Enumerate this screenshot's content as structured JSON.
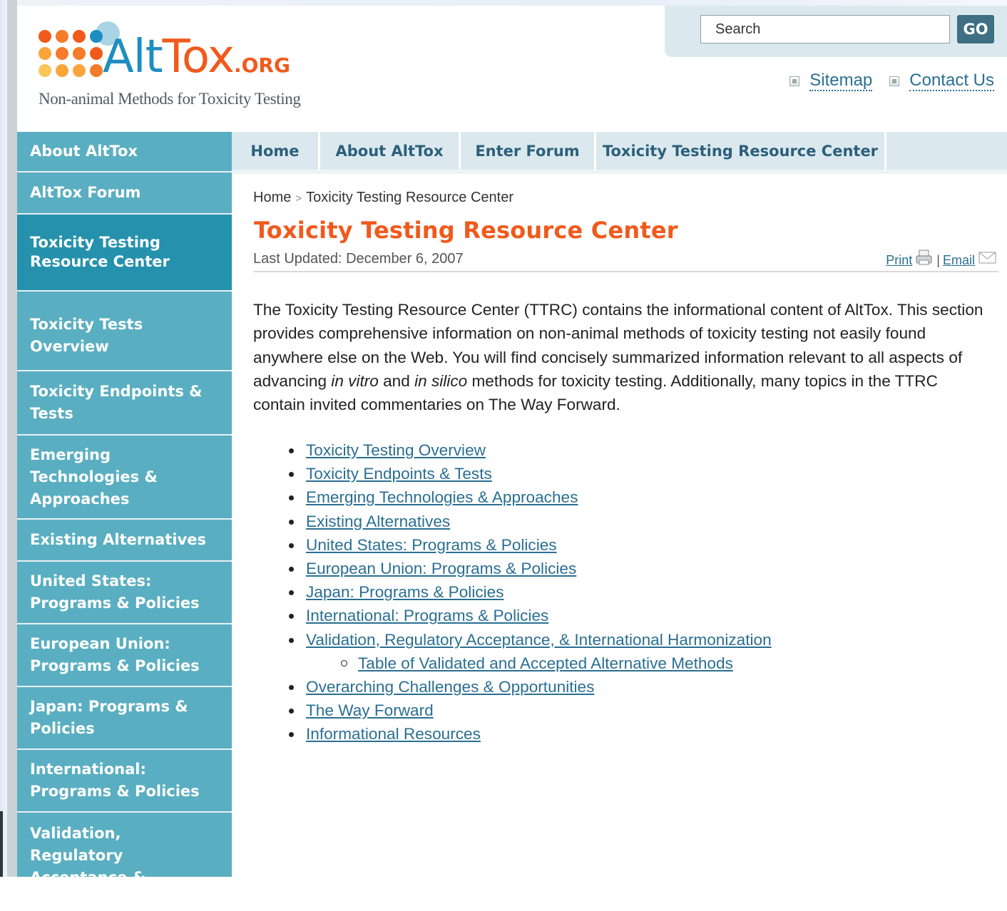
{
  "header": {
    "logo_main": "AltTox",
    "logo_alt": "Alt",
    "logo_tox": "Tox",
    "logo_org": ".ORG",
    "tagline": "Non-animal Methods for Toxicity Testing",
    "search_placeholder": "Search",
    "go_label": "GO",
    "util_links": [
      "Sitemap",
      "Contact Us"
    ],
    "colors": {
      "brand_blue": "#1e8ec0",
      "brand_orange": "#f05a1c"
    }
  },
  "sidebar": {
    "items": [
      "About AltTox",
      "AltTox Forum",
      "Toxicity Testing Resource Center",
      "Toxicity Tests Overview",
      "Toxicity Endpoints & Tests",
      "Emerging Technologies & Approaches",
      "Existing Alternatives",
      "United States: Programs & Policies",
      "European Union: Programs & Policies",
      "Japan: Programs & Policies",
      "International: Programs & Policies",
      "Validation, Regulatory Acceptance & International"
    ],
    "active_index": 2
  },
  "topnav": {
    "tabs": [
      "Home",
      "About AltTox",
      "Enter Forum",
      "Toxicity Testing Resource Center"
    ]
  },
  "content": {
    "breadcrumb_home": "Home",
    "breadcrumb_sep": ">",
    "breadcrumb_current": "Toxicity Testing Resource Center",
    "title": "Toxicity Testing Resource Center",
    "updated": "Last Updated: December 6, 2007",
    "print_label": "Print",
    "email_label": "Email",
    "divider": "|",
    "intro_1": "The Toxicity Testing Resource Center (TTRC) contains the informational content of AltTox. This section provides comprehensive information on non-animal methods of toxicity testing not easily found anywhere else on the Web. You will find concisely summarized information relevant to all aspects of advancing ",
    "intro_em1": "in vitro",
    "intro_2": " and ",
    "intro_em2": "in silico",
    "intro_3": " methods for toxicity testing. Additionally, many topics in the TTRC contain invited commentaries on The Way Forward.",
    "links": [
      "Toxicity Testing Overview",
      "Toxicity Endpoints & Tests",
      "Emerging Technologies & Approaches",
      "Existing Alternatives",
      "United States: Programs & Policies",
      "European Union: Programs & Policies",
      "Japan: Programs & Policies",
      "International: Programs & Policies",
      "Validation, Regulatory Acceptance, & International Harmonization",
      "Table of Validated and Accepted Alternative Methods",
      "Overarching Challenges & Opportunities",
      "The Way Forward",
      "Informational Resources"
    ]
  }
}
